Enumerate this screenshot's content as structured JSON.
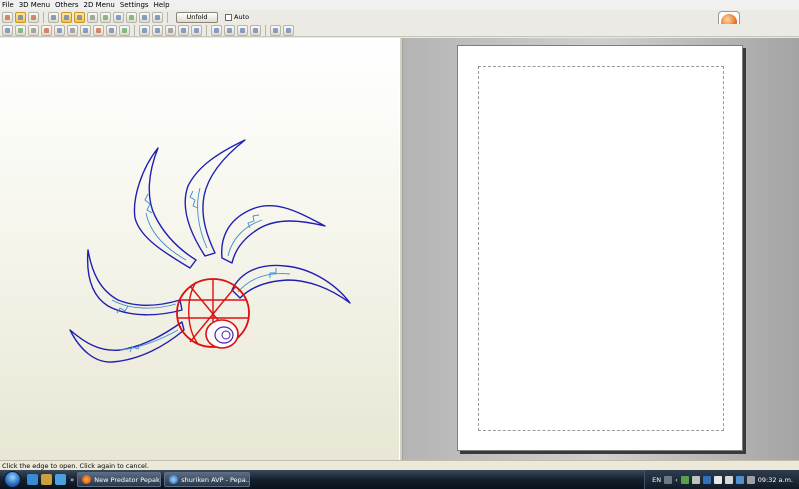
{
  "menu": {
    "items": [
      "File",
      "3D Menu",
      "Others",
      "2D Menu",
      "Settings",
      "Help"
    ]
  },
  "toolbar": {
    "unfold_label": "Unfold",
    "auto_label": "Auto",
    "auto_checked": false
  },
  "icons": {
    "app_logo": "orange-ball-logo-icon",
    "start": "windows-start-orb-icon"
  },
  "status": {
    "message": "Click the edge to open. Click again to cancel."
  },
  "taskbar": {
    "overflow_label": "»",
    "tasks": [
      {
        "label": "New Predator Pepak...",
        "icon": "firefox-icon"
      },
      {
        "label": "shuriken AVP - Pepa...",
        "icon": "pepakura-icon"
      }
    ],
    "tray": {
      "language": "EN",
      "time": "09:32 a.m."
    }
  },
  "colors": {
    "blade_outline": "#2020b0",
    "blade_detail": "#3c8cd2",
    "hub_outline": "#dd1010",
    "center_ring": "#5020b0"
  }
}
